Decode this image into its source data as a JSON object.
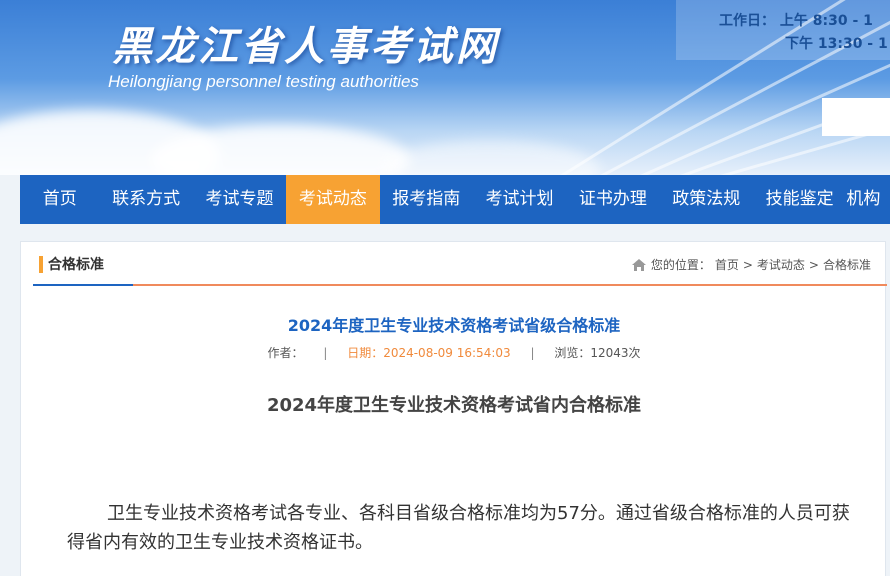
{
  "header": {
    "site_title": "黑龙江省人事考试网",
    "site_subtitle": "Heilongjiang personnel testing authorities",
    "hours_line1": "工作日： 上午   8:30 - 1",
    "hours_line2": "下午  13:30 - 1"
  },
  "nav": {
    "items": [
      "首页",
      "联系方式",
      "考试专题",
      "考试动态",
      "报考指南",
      "考试计划",
      "证书办理",
      "政策法规",
      "技能鉴定",
      "机构"
    ],
    "active": "考试动态"
  },
  "section": {
    "title": "合格标准",
    "breadcrumb_prefix": "您的位置：",
    "breadcrumb": [
      "首页",
      "考试动态",
      "合格标准"
    ]
  },
  "article": {
    "title": "2024年度卫生专业技术资格考试省级合格标准",
    "author_label": "作者：",
    "date": "日期：2024-08-09 16:54:03",
    "views": "浏览：12043次",
    "subtitle": "2024年度卫生专业技术资格考试省内合格标准",
    "body": "卫生专业技术资格考试各专业、各科目省级合格标准均为57分。通过省级合格标准的人员可获得省内有效的卫生专业技术资格证书。"
  },
  "colors": {
    "nav_bg": "#1d64c1",
    "nav_active": "#f7a233",
    "title_blue": "#1d64c1",
    "date_orange": "#f08a3c"
  },
  "icons": [
    "home-icon"
  ]
}
